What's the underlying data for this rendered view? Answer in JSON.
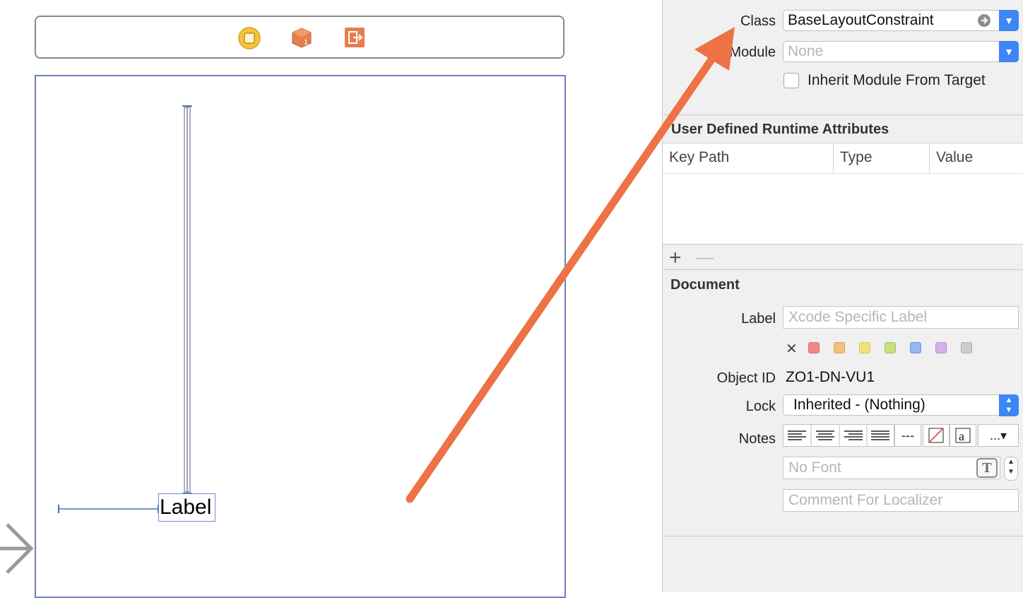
{
  "inspector": {
    "class_label": "Class",
    "class_value": "BaseLayoutConstraint",
    "module_label": "Module",
    "module_placeholder": "None",
    "inherit_label": "Inherit Module From Target",
    "runtime_title": "User Defined Runtime Attributes",
    "columns": [
      "Key Path",
      "Type",
      "Value"
    ],
    "add_symbol": "+",
    "remove_symbol": "—",
    "document_title": "Document",
    "label_label": "Label",
    "label_placeholder": "Xcode Specific Label",
    "clear_symbol": "✕",
    "label_colors": [
      "#ee8a85",
      "#f3c07b",
      "#f1e27a",
      "#c8e07f",
      "#8fb8f4",
      "#d4b0ec",
      "#cdcdcd"
    ],
    "object_id_label": "Object ID",
    "object_id_value": "ZO1-DN-VU1",
    "lock_label": "Lock",
    "lock_value": "Inherited - (Nothing)",
    "notes_label": "Notes",
    "font_placeholder": "No Font",
    "comment_placeholder": "Comment For Localizer",
    "font_button": "T",
    "more_button": "...▾"
  },
  "canvas": {
    "label_text": "Label",
    "scene_icons": [
      "view-controller-icon",
      "first-responder-icon",
      "exit-icon"
    ]
  },
  "colors": {
    "accent_blue": "#3d86f5",
    "annotation_arrow": "#ed7245",
    "scene_border": "#6f7fc4"
  }
}
